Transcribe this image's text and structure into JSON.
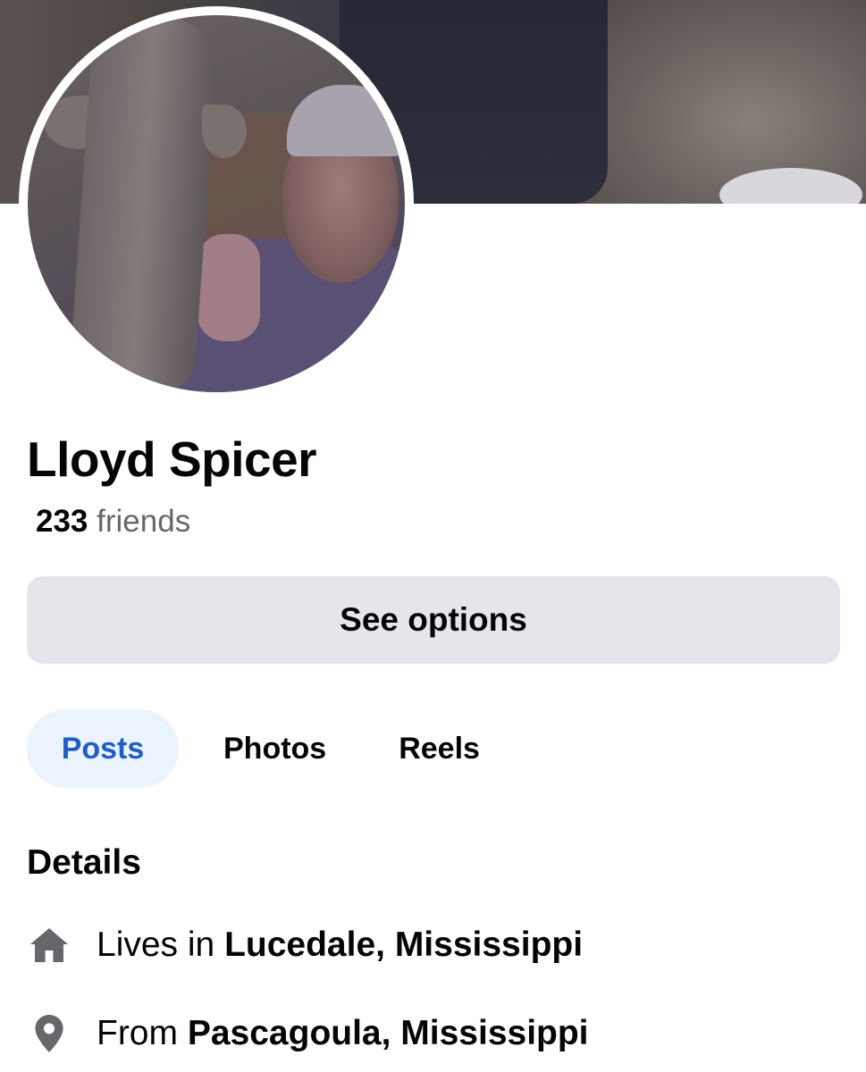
{
  "profile": {
    "name": "Lloyd Spicer",
    "friends_count": "233",
    "friends_label": "friends"
  },
  "actions": {
    "see_options_label": "See options"
  },
  "tabs": [
    {
      "label": "Posts",
      "active": true
    },
    {
      "label": "Photos",
      "active": false
    },
    {
      "label": "Reels",
      "active": false
    }
  ],
  "details": {
    "title": "Details",
    "lives_in": {
      "prefix": "Lives in",
      "place": "Lucedale, Mississippi",
      "icon": "home-icon"
    },
    "from": {
      "prefix": "From",
      "place": "Pascagoula, Mississippi",
      "icon": "location-pin-icon"
    }
  },
  "colors": {
    "active_tab_text": "#1f5ec9",
    "active_tab_bg": "#ebf3fc",
    "button_bg": "#e4e6eb",
    "secondary_text": "#65676b",
    "icon_gray": "#65676b"
  }
}
